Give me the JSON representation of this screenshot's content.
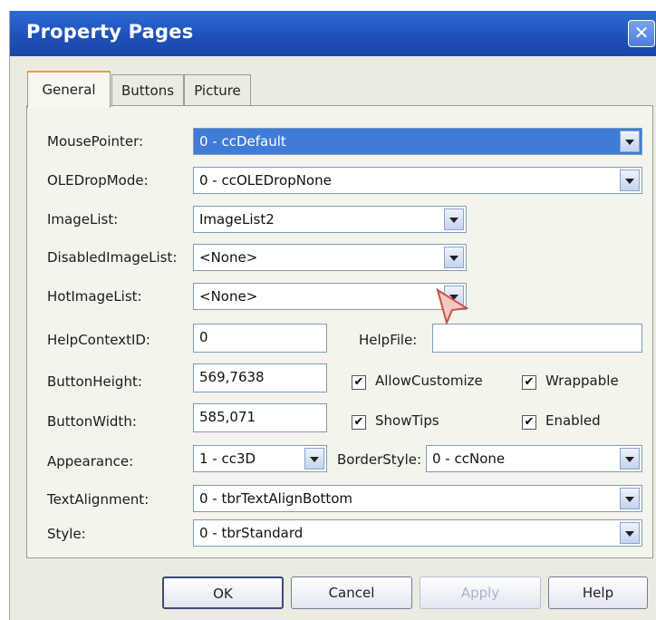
{
  "window": {
    "title": "Property Pages",
    "close_glyph": "✕"
  },
  "tabs": [
    {
      "label": "General"
    },
    {
      "label": "Buttons"
    },
    {
      "label": "Picture"
    }
  ],
  "general": {
    "mouse_pointer": {
      "label": "MousePointer:",
      "value": "0 - ccDefault"
    },
    "ole_drop_mode": {
      "label": "OLEDropMode:",
      "value": "0 - ccOLEDropNone"
    },
    "image_list": {
      "label": "ImageList:",
      "value": "ImageList2"
    },
    "disabled_image_list": {
      "label": "DisabledImageList:",
      "value": "<None>"
    },
    "hot_image_list": {
      "label": "HotImageList:",
      "value": "<None>"
    },
    "help_context_id": {
      "label": "HelpContextID:",
      "value": "0"
    },
    "help_file": {
      "label": "HelpFile:",
      "value": ""
    },
    "button_height": {
      "label": "ButtonHeight:",
      "value": "569,7638"
    },
    "button_width": {
      "label": "ButtonWidth:",
      "value": "585,071"
    },
    "appearance": {
      "label": "Appearance:",
      "value": "1 - cc3D"
    },
    "border_style": {
      "label": "BorderStyle:",
      "value": "0 - ccNone"
    },
    "text_alignment": {
      "label": "TextAlignment:",
      "value": "0 - tbrTextAlignBottom"
    },
    "style": {
      "label": "Style:",
      "value": "0 - tbrStandard"
    },
    "checkboxes": {
      "allow_customize": {
        "label": "AllowCustomize",
        "checked": true
      },
      "wrappable": {
        "label": "Wrappable",
        "checked": true
      },
      "show_tips": {
        "label": "ShowTips",
        "checked": true
      },
      "enabled": {
        "label": "Enabled",
        "checked": true
      }
    },
    "check_glyph": "✔"
  },
  "buttons": {
    "ok": "OK",
    "cancel": "Cancel",
    "apply": "Apply",
    "help": "Help"
  },
  "colors": {
    "titlebar": "#1d4fb6",
    "selection": "#3f7bd7",
    "active_tab_accent": "#e4a02b"
  }
}
